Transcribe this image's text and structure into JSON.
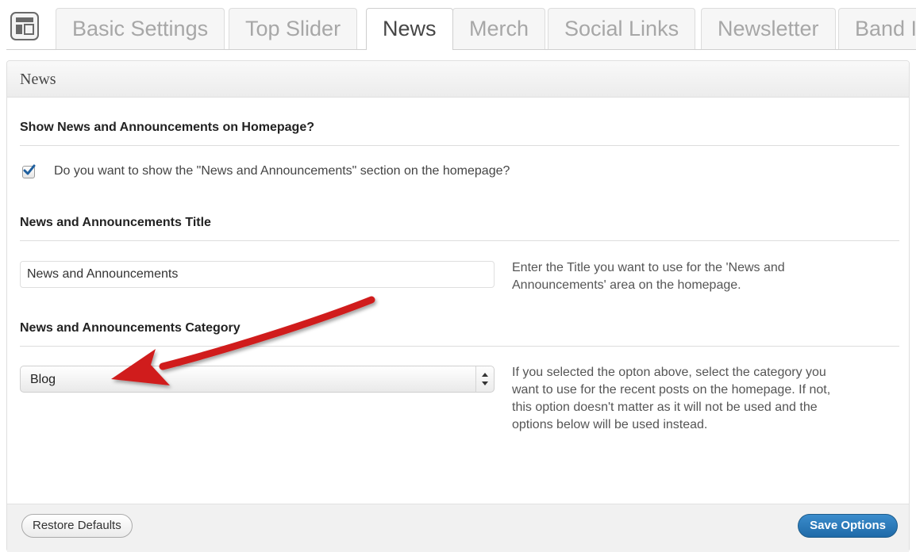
{
  "tabs": [
    {
      "label": "Basic Settings",
      "active": false
    },
    {
      "label": "Top Slider",
      "active": false
    },
    {
      "label": "News",
      "active": true
    },
    {
      "label": "Merch",
      "active": false
    },
    {
      "label": "Social Links",
      "active": false
    },
    {
      "label": "Newsletter",
      "active": false
    },
    {
      "label": "Band I",
      "active": false
    }
  ],
  "panel": {
    "title": "News",
    "show_section": {
      "heading": "Show News and Announcements on Homepage?",
      "checkbox_label": "Do you want to show the \"News and Announcements\" section on the homepage?",
      "checked": true
    },
    "title_section": {
      "heading": "News and Announcements Title",
      "input_value": "News and Announcements",
      "description": "Enter the Title you want to use for the 'News and Announcements' area on the homepage."
    },
    "category_section": {
      "heading": "News and Announcements Category",
      "selected_value": "Blog",
      "description": "If you selected the opton above, select the category you want to use for the recent posts on the homepage. If not, this option doesn't matter as it will not be used and the options below will be used instead."
    }
  },
  "footer": {
    "restore_label": "Restore Defaults",
    "save_label": "Save Options"
  },
  "colors": {
    "accent": "#2b7bbf",
    "annotation_arrow": "#d01f1f"
  },
  "icons": {
    "settings_tab": "layout-icon",
    "checkbox": "checkmark-icon",
    "select": "chevron-updown-icon"
  }
}
